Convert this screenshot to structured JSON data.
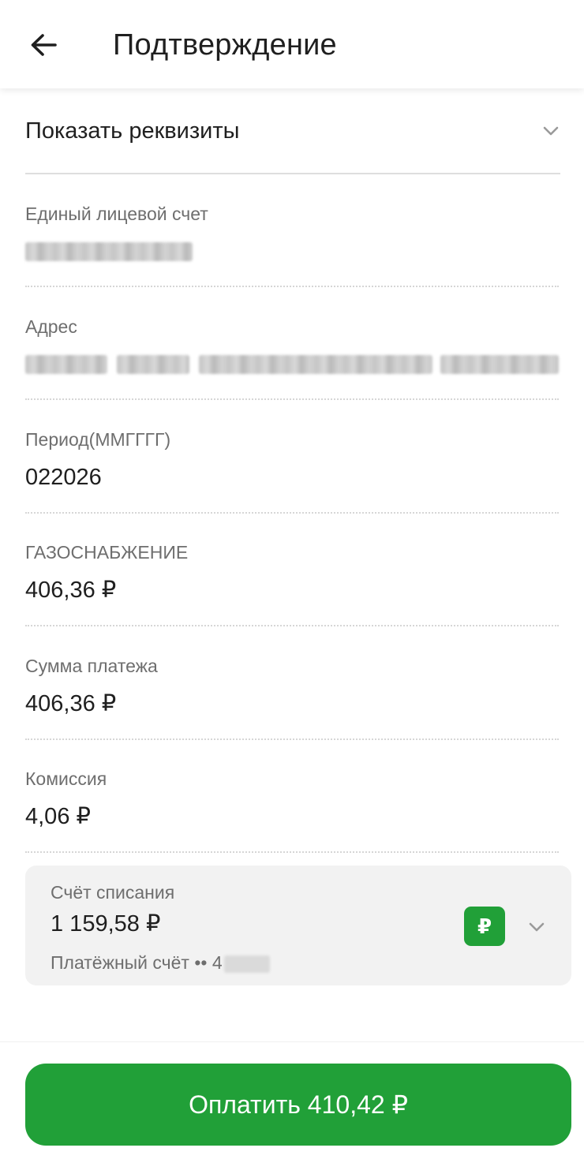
{
  "header": {
    "title": "Подтверждение",
    "back_icon": "arrow-left-icon"
  },
  "details_toggle": {
    "label": "Показать реквизиты",
    "icon": "chevron-down-icon"
  },
  "fields": [
    {
      "label": "Единый лицевой счет",
      "value": "",
      "masked": true
    },
    {
      "label": "Адрес",
      "value": "",
      "masked": true
    },
    {
      "label": "Период(ММГГГГ)",
      "value": "022026"
    },
    {
      "label": "ГАЗОСНАБЖЕНИЕ",
      "value": "406,36 ₽"
    },
    {
      "label": "Сумма платежа",
      "value": "406,36 ₽"
    },
    {
      "label": "Комиссия",
      "value": "4,06 ₽"
    }
  ],
  "debit_account": {
    "label": "Счёт списания",
    "balance": "1 159,58 ₽",
    "account_name": "Платёжный счёт •• 4",
    "badge_icon": "ruble-icon",
    "badge_symbol": "₽",
    "chevron_icon": "chevron-down-icon"
  },
  "pay_button": {
    "label": "Оплатить 410,42 ₽"
  },
  "colors": {
    "accent": "#21a038",
    "text_primary": "#1f1f1f",
    "text_secondary": "#6e6e6e",
    "card_background": "#f2f2f2"
  }
}
